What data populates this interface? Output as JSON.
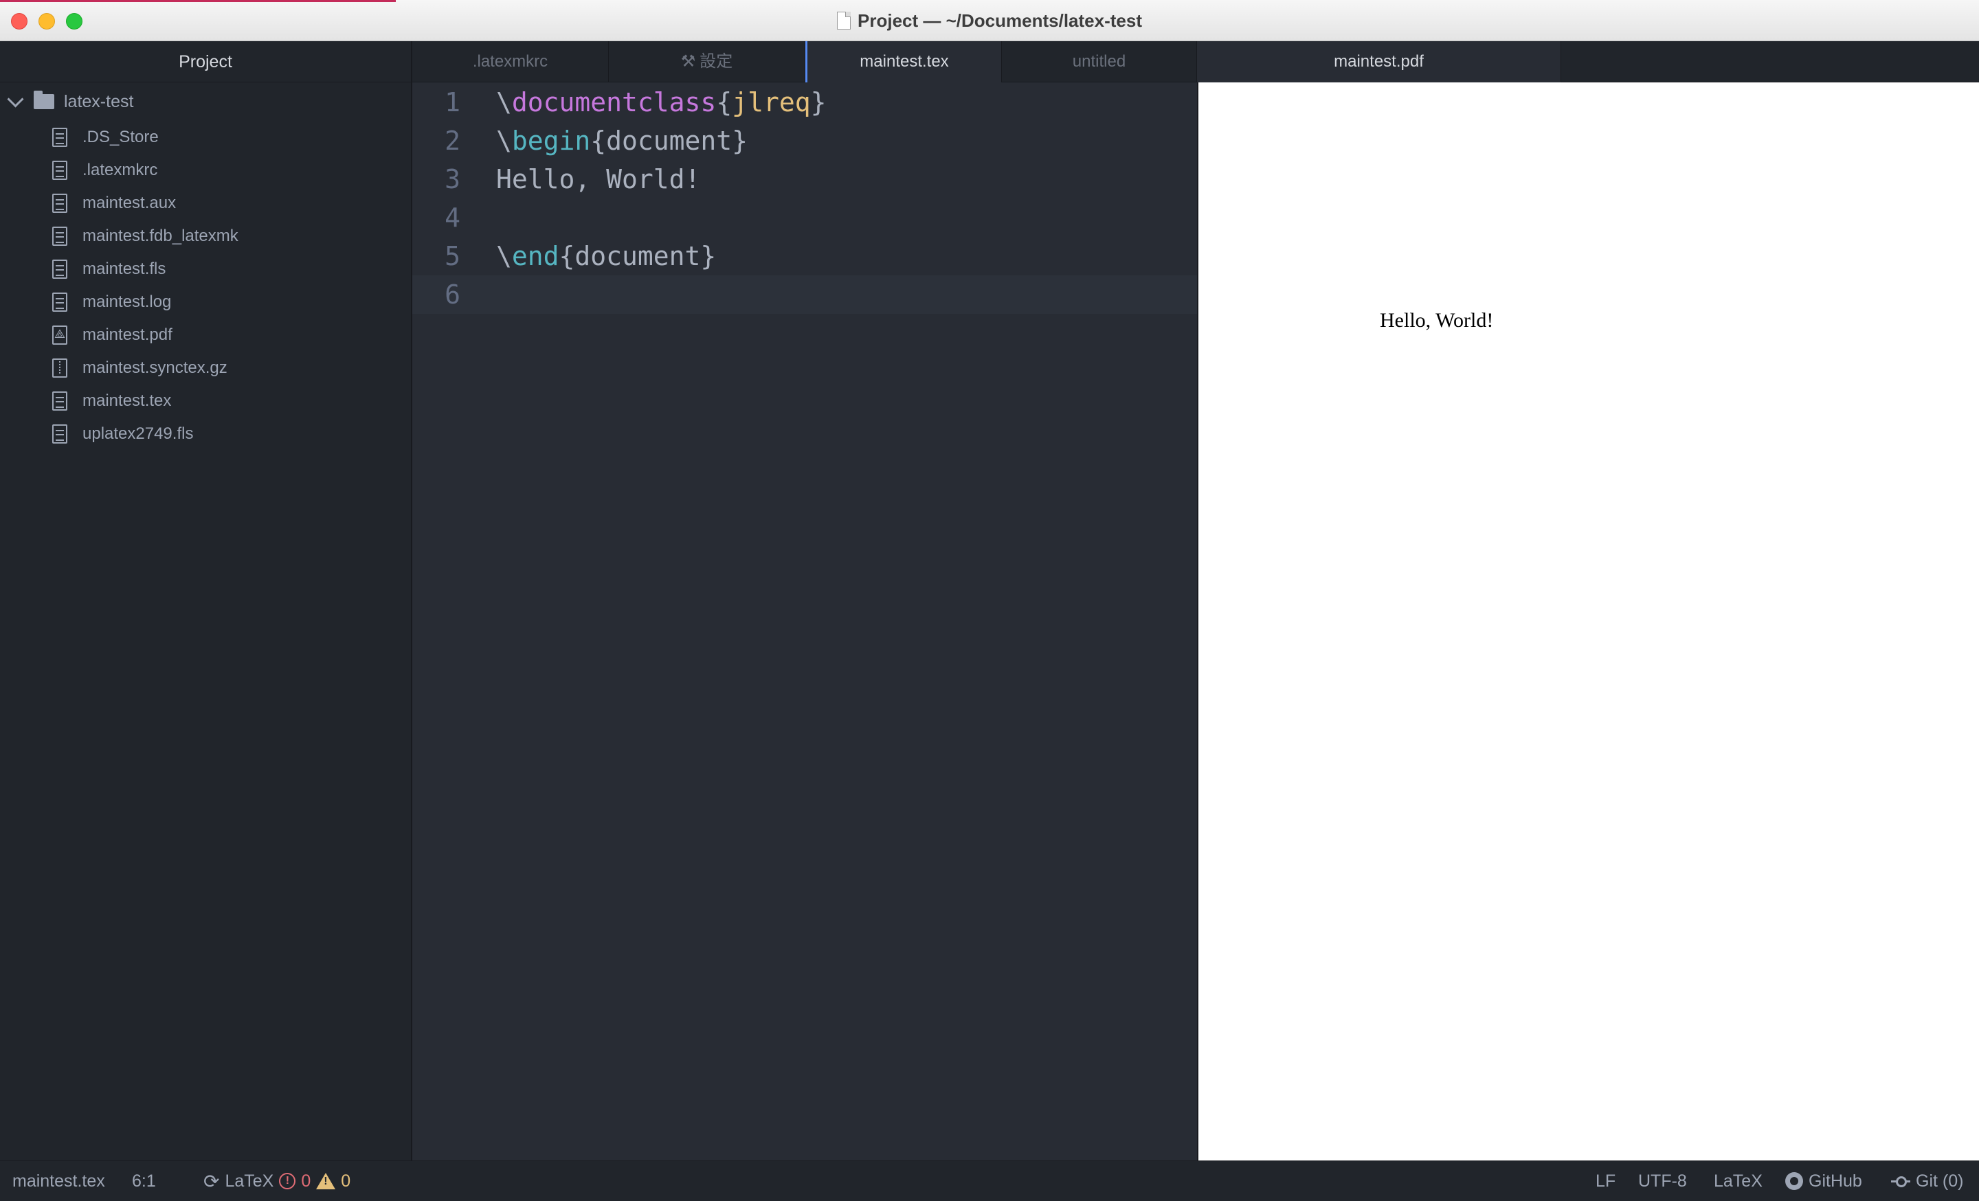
{
  "window": {
    "title": "Project — ~/Documents/latex-test"
  },
  "sidebar": {
    "header": "Project",
    "root_folder": "latex-test",
    "files": [
      {
        "name": ".DS_Store",
        "icon": "file-text-icon"
      },
      {
        "name": ".latexmkrc",
        "icon": "file-text-icon"
      },
      {
        "name": "maintest.aux",
        "icon": "file-text-icon"
      },
      {
        "name": "maintest.fdb_latexmk",
        "icon": "file-text-icon"
      },
      {
        "name": "maintest.fls",
        "icon": "file-text-icon"
      },
      {
        "name": "maintest.log",
        "icon": "file-text-icon"
      },
      {
        "name": "maintest.pdf",
        "icon": "file-pdf-icon"
      },
      {
        "name": "maintest.synctex.gz",
        "icon": "file-zip-icon"
      },
      {
        "name": "maintest.tex",
        "icon": "file-text-icon"
      },
      {
        "name": "uplatex2749.fls",
        "icon": "file-text-icon"
      }
    ]
  },
  "tabs": [
    {
      "label": ".latexmkrc",
      "active": false
    },
    {
      "label": "設定",
      "active": false,
      "icon": "wrench-icon"
    },
    {
      "label": "maintest.tex",
      "active": true
    },
    {
      "label": "untitled",
      "active": false
    },
    {
      "label": "maintest.pdf",
      "active": true
    }
  ],
  "editor": {
    "lines": [
      {
        "number": "1",
        "parts": [
          {
            "t": "\\",
            "c": ""
          },
          {
            "t": "documentclass",
            "c": "kw-purple"
          },
          {
            "t": "{",
            "c": ""
          },
          {
            "t": "jlreq",
            "c": "kw-yellow"
          },
          {
            "t": "}",
            "c": ""
          }
        ]
      },
      {
        "number": "2",
        "parts": [
          {
            "t": "\\",
            "c": ""
          },
          {
            "t": "begin",
            "c": "kw-cyan"
          },
          {
            "t": "{document}",
            "c": ""
          }
        ]
      },
      {
        "number": "3",
        "parts": [
          {
            "t": "Hello, World!",
            "c": ""
          }
        ]
      },
      {
        "number": "4",
        "parts": []
      },
      {
        "number": "5",
        "parts": [
          {
            "t": "\\",
            "c": ""
          },
          {
            "t": "end",
            "c": "kw-cyan"
          },
          {
            "t": "{document}",
            "c": ""
          }
        ]
      },
      {
        "number": "6",
        "parts": [],
        "current": true
      }
    ]
  },
  "pdf": {
    "text": "Hello, World!"
  },
  "statusbar": {
    "file": "maintest.tex",
    "cursor": "6:1",
    "grammar_build": "LaTeX",
    "errors": "0",
    "warnings": "0",
    "line_ending": "LF",
    "encoding": "UTF-8",
    "grammar": "LaTeX",
    "github": "GitHub",
    "git": "Git (0)"
  },
  "colors": {
    "keyword_purple": "#c678dd",
    "keyword_cyan": "#56b6c2",
    "keyword_yellow": "#e5c07b",
    "error": "#e06c75",
    "warning": "#e5c07b"
  }
}
